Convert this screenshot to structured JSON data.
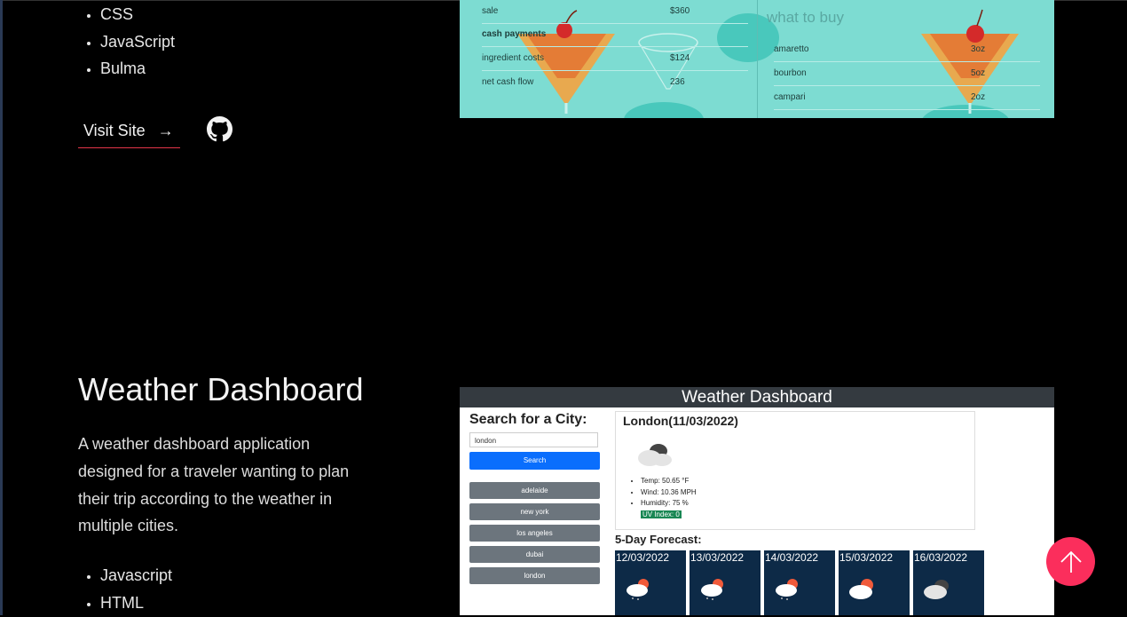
{
  "project_prev": {
    "tech": [
      "CSS",
      "JavaScript",
      "Bulma"
    ],
    "visit_label": "Visit Site",
    "visit_arrow": "→",
    "icons": {
      "github": "github-icon",
      "arrow": "arrow-right-icon"
    },
    "screenshot": {
      "cash_rows": [
        {
          "label": "sale",
          "value": "$360"
        },
        {
          "label": "cash payments",
          "value": ""
        },
        {
          "label": "ingredient costs",
          "value": "$124"
        },
        {
          "label": "net cash flow",
          "value": "236"
        }
      ],
      "buy_title": "what to buy",
      "buy_rows": [
        {
          "label": "amaretto",
          "value": "3oz"
        },
        {
          "label": "bourbon",
          "value": "5oz"
        },
        {
          "label": "campari",
          "value": "2oz"
        }
      ]
    }
  },
  "project": {
    "title": "Weather Dashboard",
    "description": "A weather dashboard application designed for a traveler wanting to plan their trip according to the weather in multiple cities.",
    "tech": [
      "Javascript",
      "HTML"
    ],
    "screenshot": {
      "header": "Weather Dashboard",
      "search_label": "Search for a City:",
      "search_value": "london",
      "search_button": "Search",
      "cities": [
        "adelaide",
        "new york",
        "los angeles",
        "dubai",
        "london"
      ],
      "current": {
        "city": "London(11/03/2022)",
        "temp": "Temp: 50.65 °F",
        "wind": "Wind: 10.36 MPH",
        "humidity": "Humidity: 75 %",
        "uv": "UV Index: 0"
      },
      "forecast_title": "5-Day Forecast:",
      "forecast_dates": [
        "12/03/2022",
        "13/03/2022",
        "14/03/2022",
        "15/03/2022",
        "16/03/2022"
      ]
    }
  },
  "colors": {
    "accent": "#fb2e5c",
    "underline": "#e3354a",
    "teal": "#7ddcd2",
    "navy": "#0d2a47"
  },
  "scroll_top_icon": "arrow-up-icon"
}
